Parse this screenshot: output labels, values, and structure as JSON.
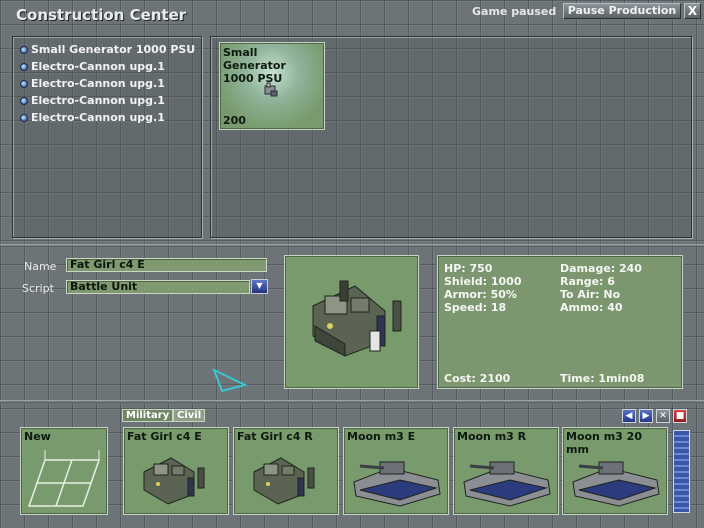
{
  "window": {
    "title": "Construction Center",
    "status": "Game paused",
    "pause_label": "Pause Production",
    "close_label": "X"
  },
  "queue": [
    {
      "label": "Small Generator 1000 PSU"
    },
    {
      "label": "Electro-Cannon upg.1"
    },
    {
      "label": "Electro-Cannon upg.1"
    },
    {
      "label": "Electro-Cannon upg.1"
    },
    {
      "label": "Electro-Cannon upg.1"
    }
  ],
  "current_build": {
    "name_line1": "Small Generator",
    "name_line2": "1000 PSU",
    "cost": "200"
  },
  "unit": {
    "name_label": "Name",
    "name_value": "Fat Girl c4 E",
    "script_label": "Script",
    "script_value": "Battle Unit"
  },
  "stats": {
    "hp": "HP: 750",
    "shield": "Shield: 1000",
    "armor": "Armor: 50%",
    "speed": "Speed: 18",
    "damage": "Damage: 240",
    "range": "Range: 6",
    "to_air": "To Air: No",
    "ammo": "Ammo: 40",
    "cost": "Cost: 2100",
    "time": "Time: 1min08"
  },
  "tabs": [
    {
      "label": "Military",
      "active": true
    },
    {
      "label": "Civil",
      "active": false
    }
  ],
  "new_tile": {
    "label": "New"
  },
  "designs": [
    {
      "label": "Fat Girl c4 E",
      "icon": "fat-girl-unit-icon"
    },
    {
      "label": "Fat Girl c4 R",
      "icon": "fat-girl-unit-icon"
    },
    {
      "label": "Moon m3 E",
      "icon": "moon-hover-unit-icon"
    },
    {
      "label": "Moon m3 R",
      "icon": "moon-hover-unit-icon"
    },
    {
      "label": "Moon m3 20 mm",
      "icon": "moon-hover-unit-icon"
    }
  ],
  "colors": {
    "tile_green": "#789a6d",
    "nav_blue": "#3b57a8",
    "delete_red": "#b52a2a"
  }
}
